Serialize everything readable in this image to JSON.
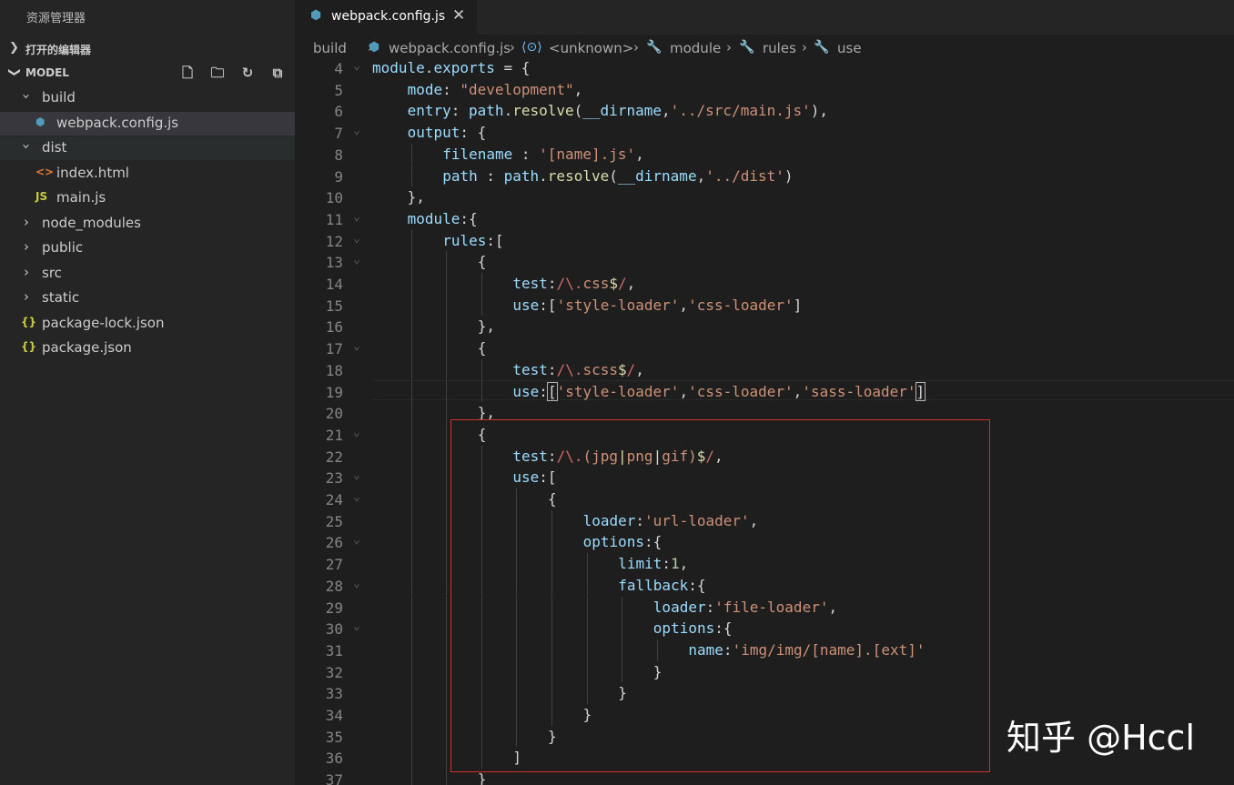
{
  "explorer": {
    "title": "资源管理器",
    "open_editors": "打开的编辑器",
    "workspace": "MODEL",
    "tools": [
      "new-file-icon",
      "new-folder-icon",
      "refresh-icon",
      "collapse-all-icon"
    ]
  },
  "tree": [
    {
      "name": "build",
      "type": "folder",
      "expanded": true,
      "depth": 0
    },
    {
      "name": "webpack.config.js",
      "type": "webpack",
      "depth": 1
    },
    {
      "name": "dist",
      "type": "folder",
      "expanded": true,
      "depth": 0
    },
    {
      "name": "index.html",
      "type": "html",
      "depth": 1
    },
    {
      "name": "main.js",
      "type": "js",
      "depth": 1
    },
    {
      "name": "node_modules",
      "type": "folder",
      "expanded": false,
      "depth": 0
    },
    {
      "name": "public",
      "type": "folder",
      "expanded": false,
      "depth": 0
    },
    {
      "name": "src",
      "type": "folder",
      "expanded": false,
      "depth": 0
    },
    {
      "name": "static",
      "type": "folder",
      "expanded": false,
      "depth": 0
    },
    {
      "name": "package-lock.json",
      "type": "json",
      "depth": 0
    },
    {
      "name": "package.json",
      "type": "json",
      "depth": 0
    }
  ],
  "tab": {
    "label": "webpack.config.js",
    "close": "✕"
  },
  "breadcrumb": {
    "items": [
      "build",
      "webpack.config.js",
      "<unknown>",
      "module",
      "rules",
      "use"
    ]
  },
  "code_lines": [
    {
      "n": "4",
      "fold": true,
      "indent": 0,
      "tokens": [
        [
          "k",
          "module"
        ],
        [
          "t",
          "."
        ],
        [
          "k",
          "exports"
        ],
        [
          "t",
          " = {"
        ]
      ]
    },
    {
      "n": "5",
      "indent": 1,
      "tokens": [
        [
          "k",
          "mode"
        ],
        [
          "t",
          ": "
        ],
        [
          "s",
          "\"development\""
        ],
        [
          "t",
          ","
        ]
      ]
    },
    {
      "n": "6",
      "indent": 1,
      "tokens": [
        [
          "k",
          "entry"
        ],
        [
          "t",
          ": "
        ],
        [
          "k",
          "path"
        ],
        [
          "t",
          "."
        ],
        [
          "f",
          "resolve"
        ],
        [
          "t",
          "("
        ],
        [
          "k",
          "__dirname"
        ],
        [
          "t",
          ","
        ],
        [
          "s",
          "'../src/main.js'"
        ],
        [
          "t",
          "),"
        ]
      ]
    },
    {
      "n": "7",
      "fold": true,
      "indent": 1,
      "tokens": [
        [
          "k",
          "output"
        ],
        [
          "t",
          ": {"
        ]
      ]
    },
    {
      "n": "8",
      "indent": 2,
      "tokens": [
        [
          "k",
          "filename"
        ],
        [
          "t",
          " : "
        ],
        [
          "s",
          "'[name].js'"
        ],
        [
          "t",
          ","
        ]
      ]
    },
    {
      "n": "9",
      "indent": 2,
      "tokens": [
        [
          "k",
          "path"
        ],
        [
          "t",
          " : "
        ],
        [
          "k",
          "path"
        ],
        [
          "t",
          "."
        ],
        [
          "f",
          "resolve"
        ],
        [
          "t",
          "("
        ],
        [
          "k",
          "__dirname"
        ],
        [
          "t",
          ","
        ],
        [
          "s",
          "'../dist'"
        ],
        [
          "t",
          ")"
        ]
      ]
    },
    {
      "n": "10",
      "indent": 1,
      "tokens": [
        [
          "t",
          "},"
        ]
      ]
    },
    {
      "n": "11",
      "fold": true,
      "indent": 1,
      "tokens": [
        [
          "k",
          "module"
        ],
        [
          "t",
          ":{"
        ]
      ]
    },
    {
      "n": "12",
      "fold": true,
      "indent": 2,
      "tokens": [
        [
          "k",
          "rules"
        ],
        [
          "t",
          ":["
        ]
      ]
    },
    {
      "n": "13",
      "fold": true,
      "indent": 3,
      "tokens": [
        [
          "t",
          "{"
        ]
      ]
    },
    {
      "n": "14",
      "indent": 4,
      "tokens": [
        [
          "k",
          "test"
        ],
        [
          "t",
          ":"
        ],
        [
          "r",
          "/\\."
        ],
        [
          "s",
          "css"
        ],
        [
          "y",
          "$"
        ],
        [
          "r",
          "/"
        ],
        [
          "t",
          ","
        ]
      ]
    },
    {
      "n": "15",
      "indent": 4,
      "tokens": [
        [
          "k",
          "use"
        ],
        [
          "t",
          ":["
        ],
        [
          "s",
          "'style-loader'"
        ],
        [
          "t",
          ","
        ],
        [
          "s",
          "'css-loader'"
        ],
        [
          "t",
          "]"
        ]
      ]
    },
    {
      "n": "16",
      "indent": 3,
      "tokens": [
        [
          "t",
          "},"
        ]
      ]
    },
    {
      "n": "17",
      "fold": true,
      "indent": 3,
      "tokens": [
        [
          "t",
          "{"
        ]
      ]
    },
    {
      "n": "18",
      "indent": 4,
      "tokens": [
        [
          "k",
          "test"
        ],
        [
          "t",
          ":"
        ],
        [
          "r",
          "/\\."
        ],
        [
          "s",
          "scss"
        ],
        [
          "y",
          "$"
        ],
        [
          "r",
          "/"
        ],
        [
          "t",
          ","
        ]
      ]
    },
    {
      "n": "19",
      "indent": 4,
      "tokens": [
        [
          "k",
          "use"
        ],
        [
          "t",
          ":"
        ],
        [
          "bm",
          "["
        ],
        [
          "s",
          "'style-loader'"
        ],
        [
          "t",
          ","
        ],
        [
          "s",
          "'css-loader'"
        ],
        [
          "t",
          ","
        ],
        [
          "s",
          "'sass-loader'"
        ],
        [
          "bm",
          "]"
        ]
      ]
    },
    {
      "n": "20",
      "indent": 3,
      "tokens": [
        [
          "t",
          "},"
        ]
      ]
    },
    {
      "n": "21",
      "fold": true,
      "indent": 3,
      "tokens": [
        [
          "t",
          "{"
        ]
      ]
    },
    {
      "n": "22",
      "indent": 4,
      "tokens": [
        [
          "k",
          "test"
        ],
        [
          "t",
          ":"
        ],
        [
          "r",
          "/\\."
        ],
        [
          "s",
          "("
        ],
        [
          "s",
          "jpg"
        ],
        [
          "y",
          "|"
        ],
        [
          "s",
          "png"
        ],
        [
          "y",
          "|"
        ],
        [
          "s",
          "gif"
        ],
        [
          "s",
          ")"
        ],
        [
          "y",
          "$"
        ],
        [
          "r",
          "/"
        ],
        [
          "t",
          ","
        ]
      ]
    },
    {
      "n": "23",
      "fold": true,
      "indent": 4,
      "tokens": [
        [
          "k",
          "use"
        ],
        [
          "t",
          ":["
        ]
      ]
    },
    {
      "n": "24",
      "fold": true,
      "indent": 5,
      "tokens": [
        [
          "t",
          "{"
        ]
      ]
    },
    {
      "n": "25",
      "indent": 6,
      "tokens": [
        [
          "k",
          "loader"
        ],
        [
          "t",
          ":"
        ],
        [
          "s",
          "'url-loader'"
        ],
        [
          "t",
          ","
        ]
      ]
    },
    {
      "n": "26",
      "fold": true,
      "indent": 6,
      "tokens": [
        [
          "k",
          "options"
        ],
        [
          "t",
          ":{"
        ]
      ]
    },
    {
      "n": "27",
      "indent": 7,
      "tokens": [
        [
          "k",
          "limit"
        ],
        [
          "t",
          ":"
        ],
        [
          "n",
          "1"
        ],
        [
          "t",
          ","
        ]
      ]
    },
    {
      "n": "28",
      "fold": true,
      "indent": 7,
      "tokens": [
        [
          "k",
          "fallback"
        ],
        [
          "t",
          ":{"
        ]
      ]
    },
    {
      "n": "29",
      "indent": 8,
      "tokens": [
        [
          "k",
          "loader"
        ],
        [
          "t",
          ":"
        ],
        [
          "s",
          "'file-loader'"
        ],
        [
          "t",
          ","
        ]
      ]
    },
    {
      "n": "30",
      "fold": true,
      "indent": 8,
      "tokens": [
        [
          "k",
          "options"
        ],
        [
          "t",
          ":{"
        ]
      ]
    },
    {
      "n": "31",
      "indent": 9,
      "tokens": [
        [
          "k",
          "name"
        ],
        [
          "t",
          ":"
        ],
        [
          "s",
          "'img/img/[name].[ext]'"
        ]
      ]
    },
    {
      "n": "32",
      "indent": 8,
      "tokens": [
        [
          "t",
          "}"
        ]
      ]
    },
    {
      "n": "33",
      "indent": 7,
      "tokens": [
        [
          "t",
          "}"
        ]
      ]
    },
    {
      "n": "34",
      "indent": 6,
      "tokens": [
        [
          "t",
          "}"
        ]
      ]
    },
    {
      "n": "35",
      "indent": 5,
      "tokens": [
        [
          "t",
          "}"
        ]
      ]
    },
    {
      "n": "36",
      "indent": 4,
      "tokens": [
        [
          "t",
          "]"
        ]
      ]
    },
    {
      "n": "37",
      "indent": 3,
      "tokens": [
        [
          "t",
          "}"
        ]
      ]
    }
  ],
  "watermark": "知乎 @Hccl",
  "colors": {
    "highlight_box": "#d0302d",
    "accent": "#519aba"
  }
}
